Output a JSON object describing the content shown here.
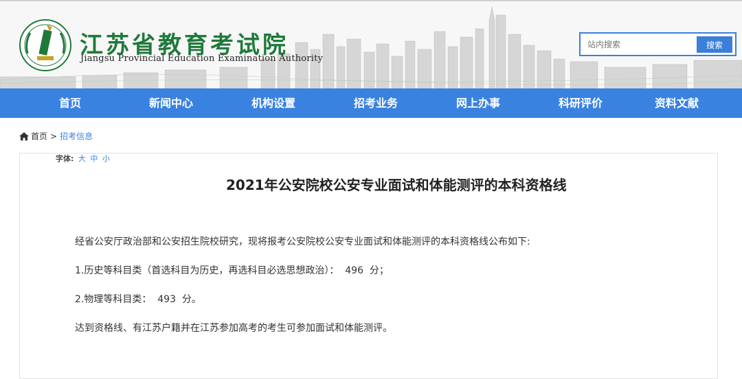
{
  "header": {
    "site_name": "江苏省教育考试院",
    "site_name_en": "Jiangsu Provincial Education Examination Authority"
  },
  "search": {
    "placeholder": "站内搜索",
    "button_label": "搜索"
  },
  "nav": {
    "items": [
      {
        "label": "首页"
      },
      {
        "label": "新闻中心"
      },
      {
        "label": "机构设置"
      },
      {
        "label": "招考业务"
      },
      {
        "label": "网上办事"
      },
      {
        "label": "科研评价"
      },
      {
        "label": "资料文献"
      }
    ]
  },
  "breadcrumb": {
    "home": "首页",
    "separator": ">",
    "current": "招考信息"
  },
  "font_control": {
    "label": "字体:",
    "large": "大",
    "medium": "中",
    "small": "小"
  },
  "article": {
    "title": "2021年公安院校公安专业面试和体能测评的本科资格线",
    "paragraphs": [
      "经省公安厅政治部和公安招生院校研究，现将报考公安院校公安专业面试和体能测评的本科资格线公布如下:",
      "1.历史等科目类（首选科目为历史，再选科目必选思想政治）：  496  分；",
      "2.物理等科目类：  493  分。",
      "达到资格线、有江苏户籍并在江苏参加高考的考生可参加面试和体能测评。"
    ]
  },
  "colors": {
    "nav_bg": "#3a82e0",
    "logo_green": "#1f7a3a",
    "link_blue": "#3a82e0"
  }
}
